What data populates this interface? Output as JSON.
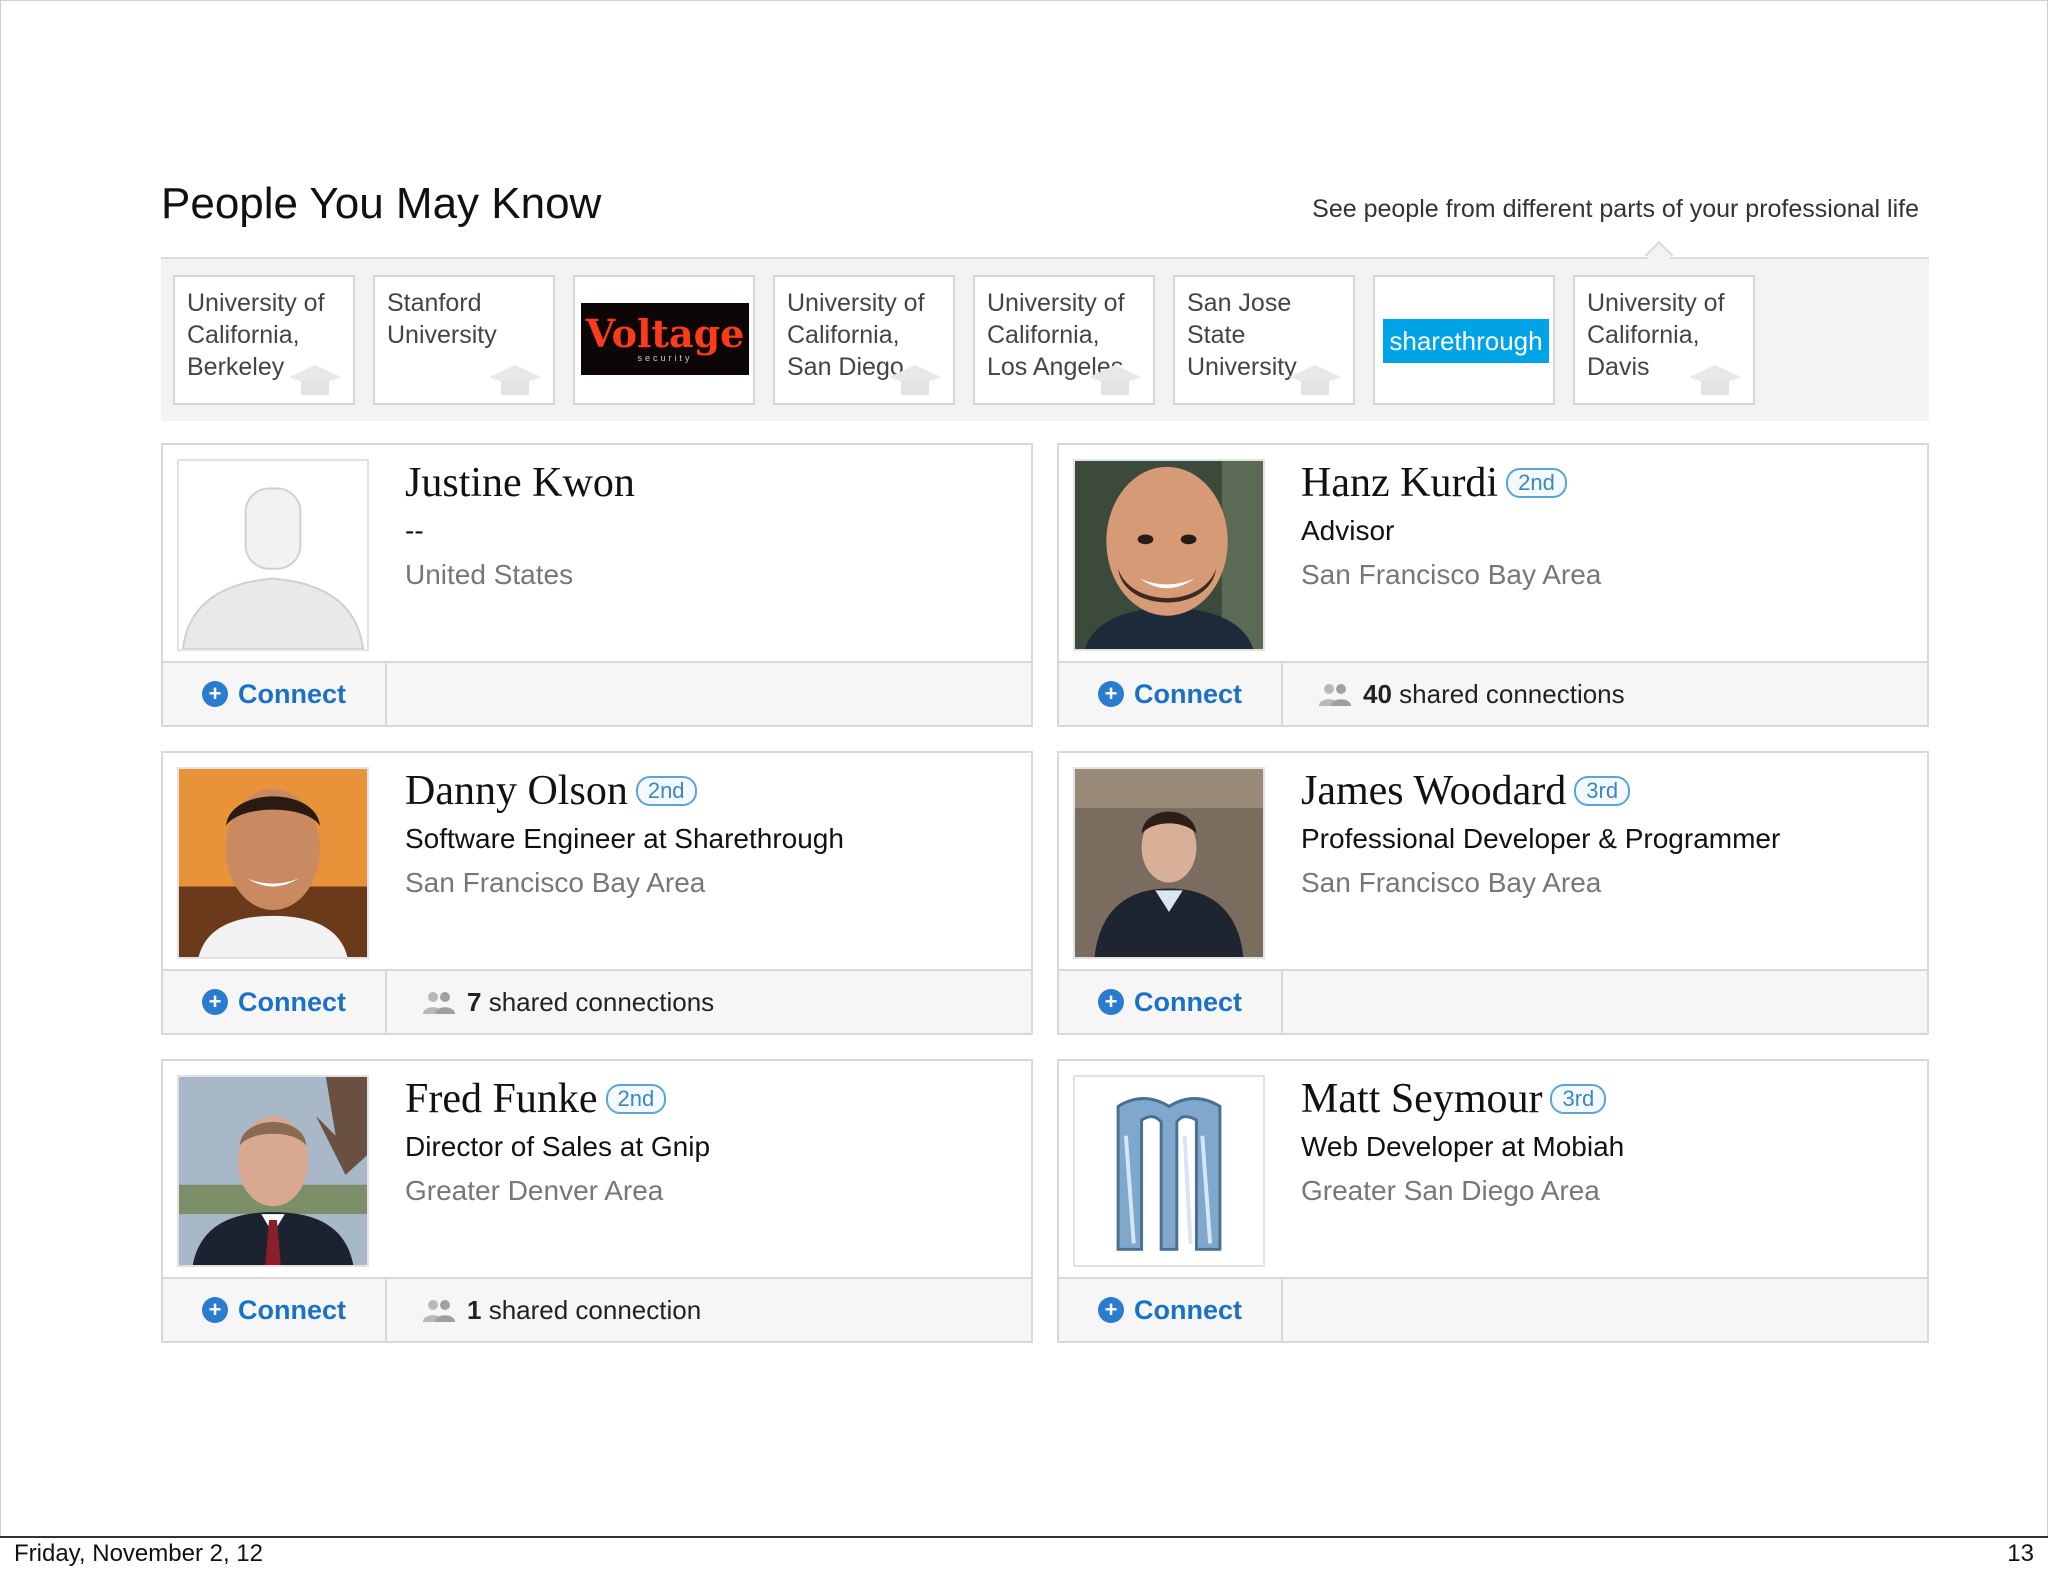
{
  "header": {
    "title": "People You May Know",
    "subtitle": "See people from different parts of your professional life"
  },
  "tabs": [
    {
      "label": "University of California, Berkeley",
      "lines": [
        "University of",
        "California,",
        "Berkeley"
      ]
    },
    {
      "label": "Stanford University",
      "lines": [
        "Stanford",
        "University",
        ""
      ]
    },
    {
      "label": "Voltage Security",
      "logo": "Voltage",
      "logo_sub": "security",
      "logo_color": "#ff3a1a"
    },
    {
      "label": "University of California, San Diego",
      "lines": [
        "University of",
        "California,",
        "San Diego"
      ]
    },
    {
      "label": "University of California, Los Angeles",
      "lines": [
        "University of",
        "California,",
        "Los Angeles"
      ]
    },
    {
      "label": "San Jose State University",
      "lines": [
        "San Jose",
        "State",
        "University"
      ]
    },
    {
      "label": "Sharethrough",
      "logo": "sharethrough",
      "logo_color": "#00a3e6"
    },
    {
      "label": "University of California, Davis",
      "lines": [
        "University of",
        "California,",
        "Davis"
      ]
    }
  ],
  "connect_label": "Connect",
  "people": [
    {
      "name": "Justine Kwon",
      "degree": "",
      "headline": "--",
      "location": "United States",
      "shared_count": "",
      "shared_text": "",
      "photo": "default-avatar"
    },
    {
      "name": "Hanz Kurdi",
      "degree": "2nd",
      "headline": "Advisor",
      "location": "San Francisco Bay Area",
      "shared_count": "40",
      "shared_text": "shared connections",
      "photo": "bald-man-photo"
    },
    {
      "name": "Danny Olson",
      "degree": "2nd",
      "headline": "Software Engineer at Sharethrough",
      "location": "San Francisco Bay Area",
      "shared_count": "7",
      "shared_text": "shared connections",
      "photo": "sunset-portrait-photo"
    },
    {
      "name": "James Woodard",
      "degree": "3rd",
      "headline": "Professional Developer & Programmer",
      "location": "San Francisco Bay Area",
      "shared_count": "",
      "shared_text": "",
      "photo": "sweater-portrait-photo"
    },
    {
      "name": "Fred Funke",
      "degree": "2nd",
      "headline": "Director of Sales at Gnip",
      "location": "Greater Denver Area",
      "shared_count": "1",
      "shared_text": "shared connection",
      "photo": "suit-portrait-photo"
    },
    {
      "name": "Matt Seymour",
      "degree": "3rd",
      "headline": "Web Developer at Mobiah",
      "location": "Greater San Diego Area",
      "shared_count": "",
      "shared_text": "",
      "photo": "m-logo-photo"
    }
  ],
  "footer": {
    "date": "Friday, November 2, 12",
    "page": "13"
  },
  "colors": {
    "link_blue": "#1b72c5",
    "degree_blue": "#3b88c0",
    "strip_gray": "#f3f3f3"
  }
}
